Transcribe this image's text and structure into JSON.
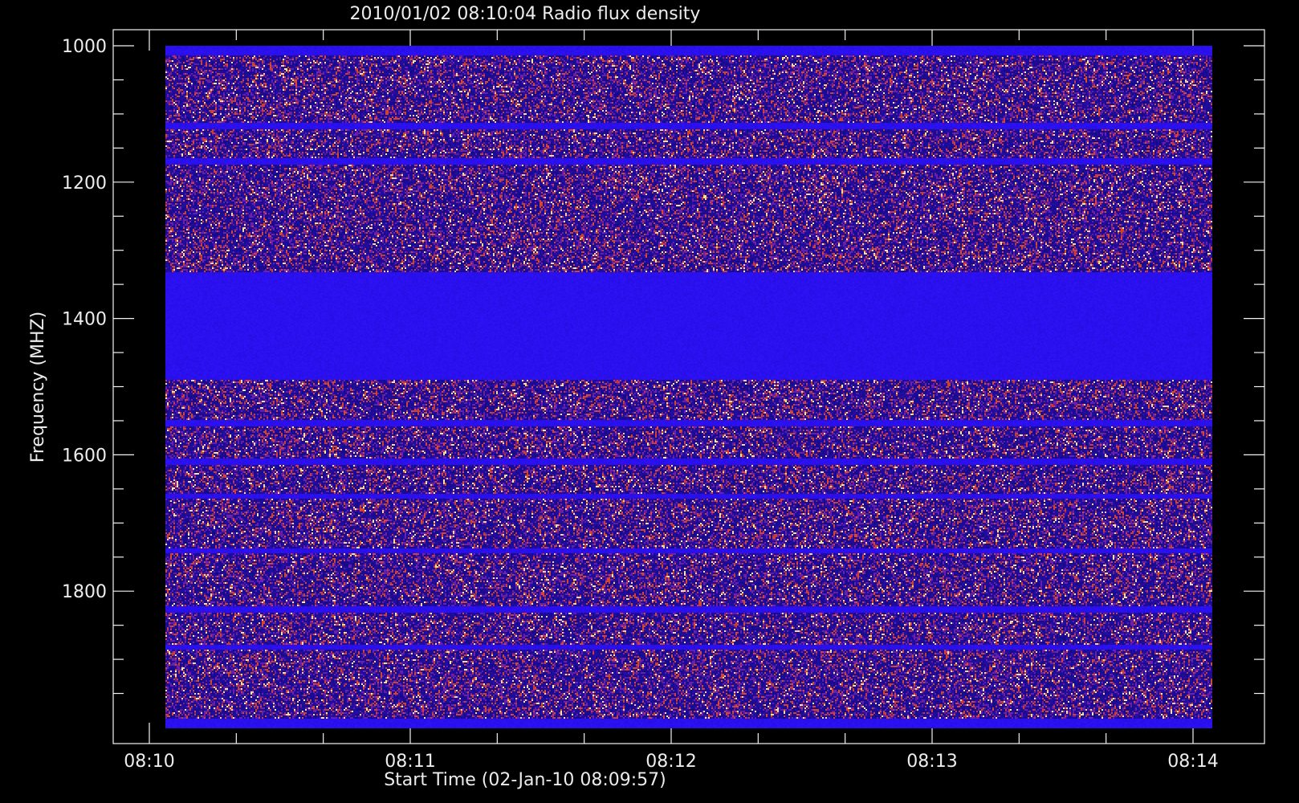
{
  "chart_data": {
    "type": "heatmap",
    "title": "2010/01/02 08:10:04 Radio flux density",
    "xlabel": "Start Time (02-Jan-10 08:09:57)",
    "ylabel": "Frequency (MHZ)",
    "x_ticks": [
      "08:10",
      "08:11",
      "08:12",
      "08:13",
      "08:14"
    ],
    "y_ticks": [
      1000,
      1200,
      1400,
      1600,
      1800
    ],
    "xlim": [
      "08:09:57",
      "08:14:13"
    ],
    "ylim": [
      1000,
      2000
    ],
    "y_inverted": true,
    "colors": {
      "background": "#000000",
      "low": "#2a10ee",
      "medium": "#5a1a8f",
      "high": "#c0391f"
    },
    "bands": [
      {
        "from": 1000,
        "to": 1335,
        "level": "noisy"
      },
      {
        "from": 1335,
        "to": 1490,
        "level": "quiet"
      },
      {
        "from": 1490,
        "to": 1990,
        "level": "noisy"
      }
    ],
    "quiet_lines": [
      1117,
      1169,
      1335,
      1553,
      1610,
      1661,
      1740,
      1827,
      1882,
      1990
    ]
  }
}
